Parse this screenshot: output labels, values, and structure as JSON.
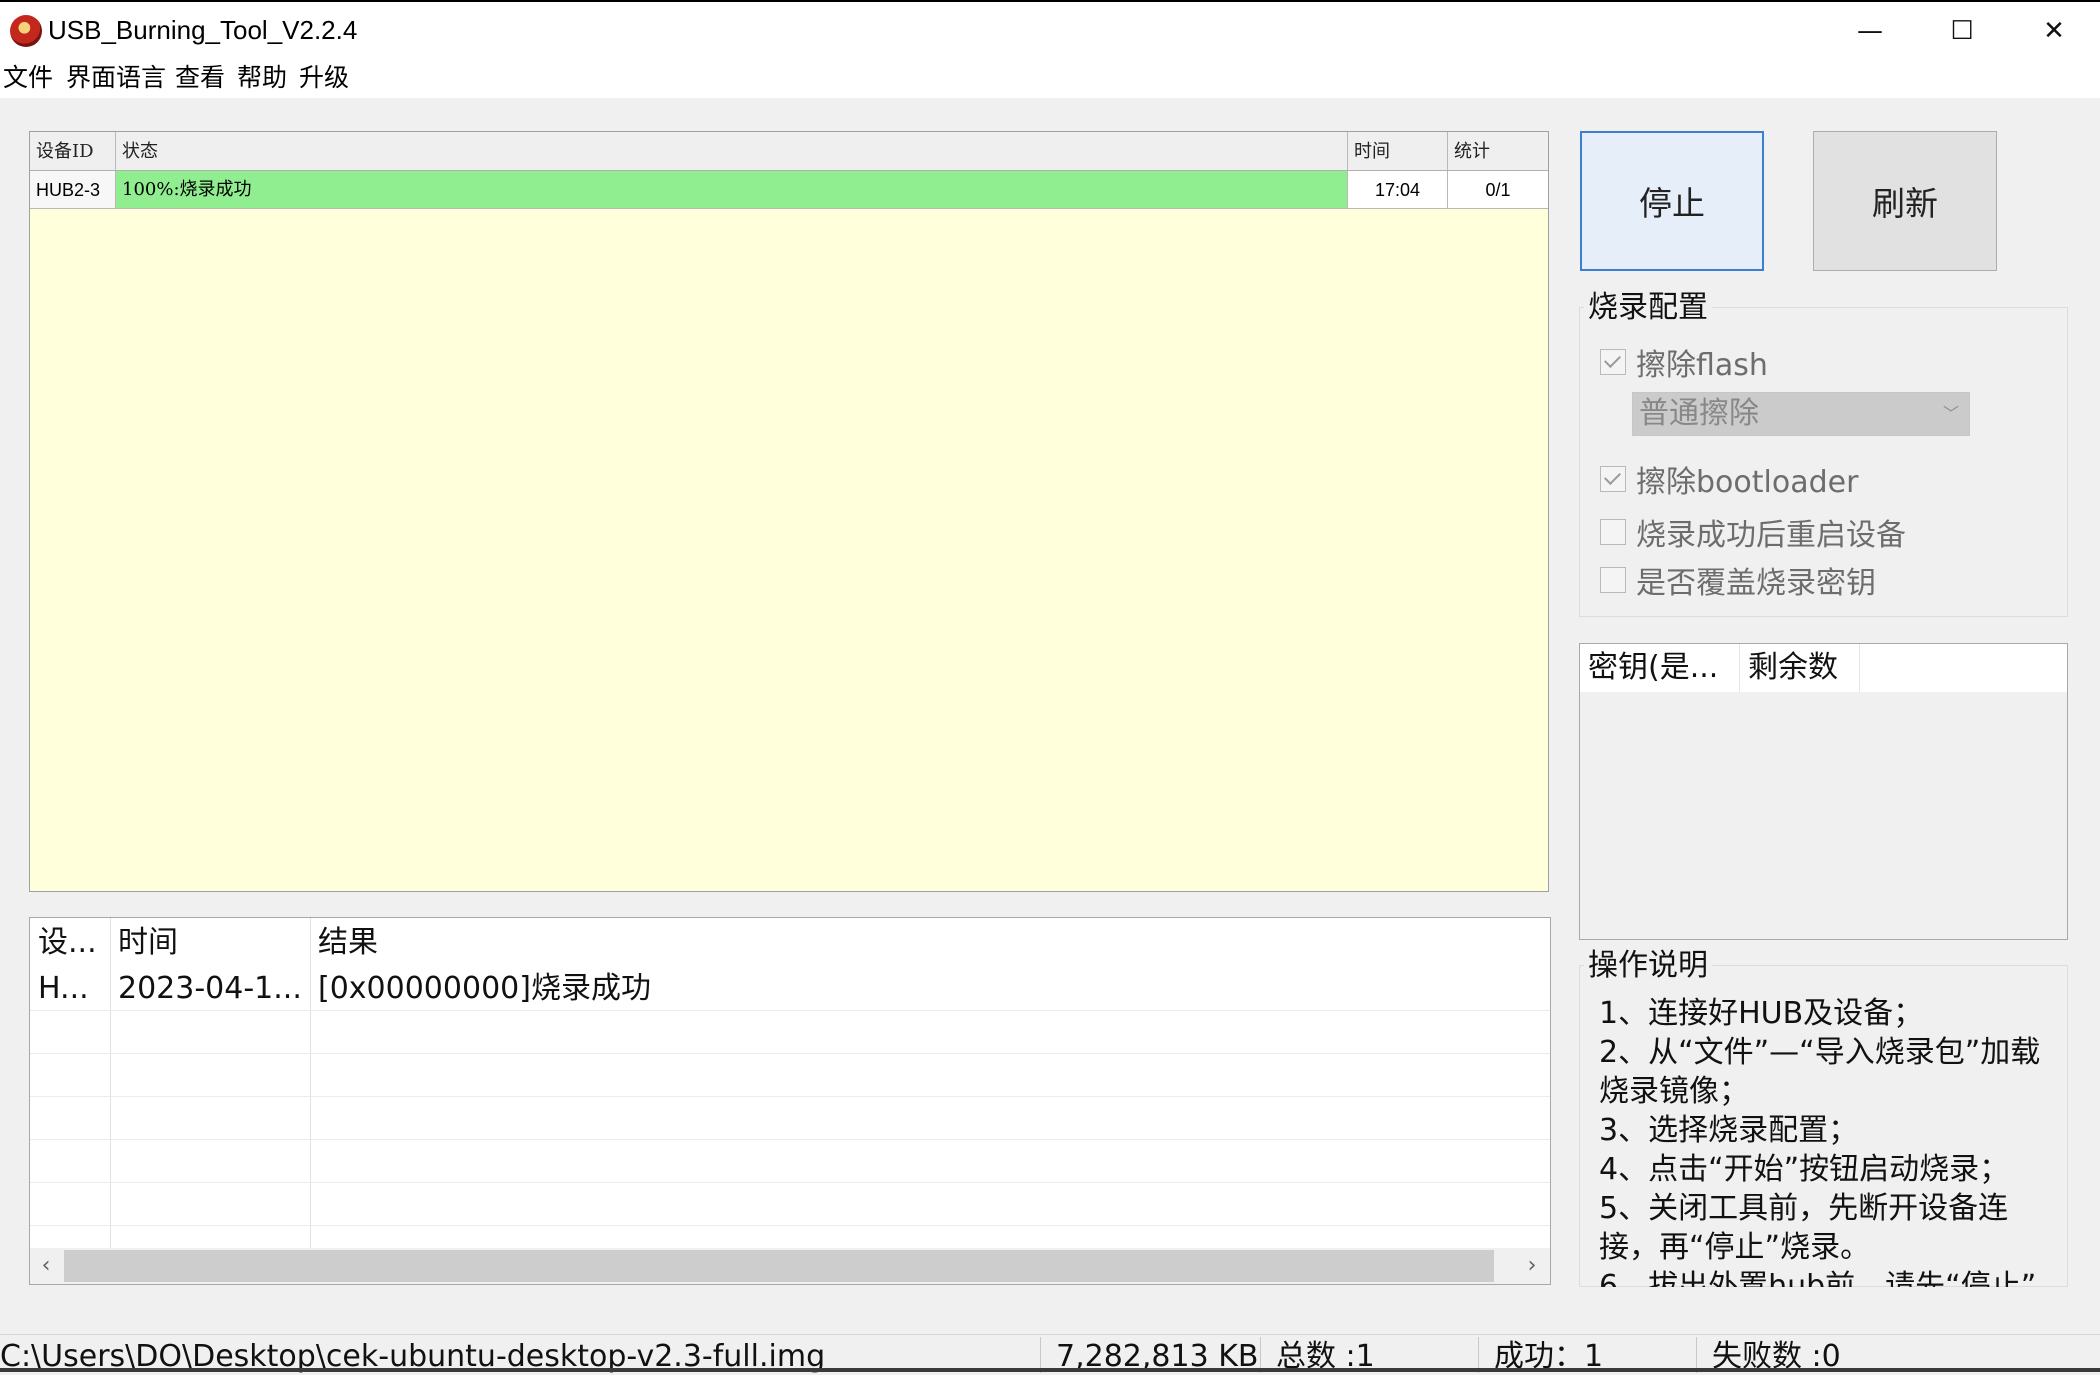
{
  "window": {
    "title": "USB_Burning_Tool_V2.2.4",
    "icon": "app-logo-icon",
    "controls": {
      "minimize": "—",
      "maximize": "☐",
      "close": "✕"
    }
  },
  "menu": [
    "文件",
    "界面语言",
    "查看",
    "帮助",
    "升级"
  ],
  "device_table": {
    "headers": [
      "设备ID",
      "状态",
      "时间",
      "统计"
    ],
    "rows": [
      {
        "id": "HUB2-3",
        "status": "100%:烧录成功",
        "progress": 1.0,
        "time": "17:04",
        "stats": "0/1"
      }
    ],
    "colors": {
      "background": "#ffffdc",
      "progress": "#90ee90"
    }
  },
  "log_table": {
    "headers": [
      "设...",
      "时间",
      "结果"
    ],
    "rows": [
      {
        "device": "H...",
        "time": "2023-04-1...",
        "result": "[0x00000000]烧录成功"
      }
    ]
  },
  "buttons": {
    "stop": "停止",
    "refresh": "刷新"
  },
  "burn_config": {
    "title": "烧录配置",
    "erase_flash": {
      "label": "擦除flash",
      "checked": true
    },
    "erase_mode": "普通擦除",
    "erase_bootloader": {
      "label": "擦除bootloader",
      "checked": true
    },
    "reboot_after": {
      "label": "烧录成功后重启设备",
      "checked": false
    },
    "overwrite_key": {
      "label": "是否覆盖烧录密钥",
      "checked": false
    }
  },
  "key_list": {
    "headers": [
      "密钥(是...",
      "剩余数"
    ]
  },
  "instructions": {
    "title": "操作说明",
    "steps": [
      "1、连接好HUB及设备；",
      "2、从“文件”—“导入烧录包”加载烧录镜像；",
      "3、选择烧录配置；",
      "4、点击“开始”按钮启动烧录；",
      "5、关闭工具前，先断开设备连接，再“停止”烧录。",
      "6、拔出外置hub前，请先“停止”"
    ]
  },
  "status_bar": {
    "file_path": "C:\\Users\\DO\\Desktop\\cek-ubuntu-desktop-v2.3-full.img",
    "file_size": "7,282,813 KB",
    "total": "总数 :1",
    "success": "成功：1",
    "failed": "失败数 :0"
  }
}
